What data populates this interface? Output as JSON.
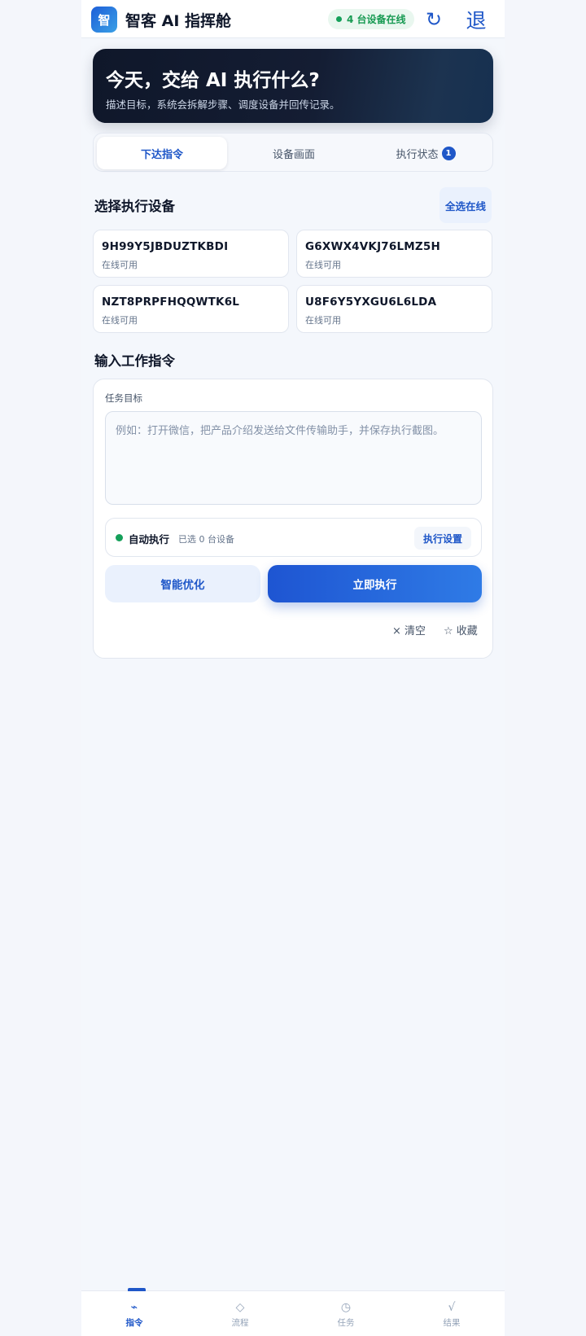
{
  "header": {
    "logo_char": "智",
    "title": "智客 AI 指挥舱",
    "online_badge": "4 台设备在线",
    "refresh_glyph": "↻",
    "logout_label": "退"
  },
  "hero": {
    "title": "今天，交给 AI 执行什么?",
    "subtitle": "描述目标，系统会拆解步骤、调度设备并回传记录。"
  },
  "tabs": [
    {
      "label": "下达指令",
      "active": true
    },
    {
      "label": "设备画面",
      "active": false
    },
    {
      "label": "执行状态",
      "badge": "1",
      "active": false
    }
  ],
  "devices_section": {
    "title": "选择执行设备",
    "select_all_label": "全选在线",
    "devices": [
      {
        "id": "9H99Y5JBDUZTKBDI",
        "status": "在线可用"
      },
      {
        "id": "G6XWX4VKJ76LMZ5H",
        "status": "在线可用"
      },
      {
        "id": "NZT8PRPFHQQWTK6L",
        "status": "在线可用"
      },
      {
        "id": "U8F6Y5YXGU6L6LDA",
        "status": "在线可用"
      }
    ]
  },
  "command_section": {
    "title": "输入工作指令",
    "field_label": "任务目标",
    "placeholder": "例如：打开微信，把产品介绍发送给文件传输助手，并保存执行截图。",
    "value": "",
    "auto_label": "自动执行",
    "auto_meta": "已选 0 台设备",
    "settings_label": "执行设置",
    "optimize_label": "智能优化",
    "run_label": "立即执行",
    "clear_label": "× 清空",
    "favorite_label": "☆ 收藏"
  },
  "bottom_nav": [
    {
      "icon": "⌁",
      "icon_name": "command-icon",
      "label": "指令",
      "active": true
    },
    {
      "icon": "◇",
      "icon_name": "flow-icon",
      "label": "流程",
      "active": false
    },
    {
      "icon": "◷",
      "icon_name": "clock-icon",
      "label": "任务",
      "active": false
    },
    {
      "icon": "√",
      "icon_name": "check-icon",
      "label": "结果",
      "active": false
    }
  ],
  "colors": {
    "accent": "#1f57c8",
    "online_green": "#15a05a",
    "hero_dark": "#0f172a"
  }
}
